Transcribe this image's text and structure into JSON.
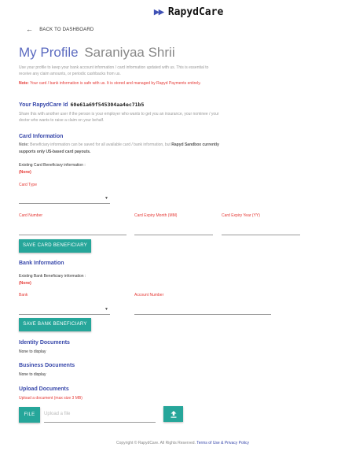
{
  "brand": {
    "name": "RapydCare",
    "arrows": "▶▶"
  },
  "nav": {
    "back_label": "BACK TO DASHBOARD",
    "back_icon": "←"
  },
  "header": {
    "title": "My Profile",
    "user_name": "Saraniyaa Shrii"
  },
  "intro": {
    "line1": "Use your profile to keep your bank account information / card information updated with us. This is essential to",
    "line2": "receive any claim amounts, or periodic cashbacks from us.",
    "note_label": "Note:",
    "note_text": "Your card / bank information is safe with us. It is stored and managed by Rapyd Payments entirely."
  },
  "rapydcare_id": {
    "label": "Your RapydCare Id",
    "value": "60e61a69f545304aa4ec71b5",
    "help1": "Share this with another user if the person is your employer who wants to get you an insurance, your nominee / your",
    "help2": "doctor who wants to raise a claim on your behalf."
  },
  "card_info": {
    "heading": "Card Information",
    "note_label": "Note:",
    "note_text": "Beneficiary information can be saved for all available card / bank information, but",
    "note_bold": "Rapyd Sandbox currently",
    "note_line2": "supports only US-based card payouts.",
    "existing_label": "Existing Card Beneficiary information :",
    "existing_value": "(None)",
    "card_type_label": "Card Type",
    "card_number_label": "Card Number",
    "expiry_month_label": "Card Expiry Month (MM)",
    "expiry_year_label": "Card Expiry Year (YY)",
    "save_button": "SAVE CARD BENEFICIARY"
  },
  "bank_info": {
    "heading": "Bank Information",
    "existing_label": "Existing Bank Beneficiary information :",
    "existing_value": "(None)",
    "bank_label": "Bank",
    "account_label": "Account Number",
    "save_button": "SAVE BANK BENEFICIARY"
  },
  "identity_docs": {
    "heading": "Identity Documents",
    "empty": "None to display"
  },
  "business_docs": {
    "heading": "Business Documents",
    "empty": "None to display"
  },
  "upload": {
    "heading": "Upload Documents",
    "hint": "Upload a document (max size 3 MB)",
    "file_button": "FILE",
    "placeholder": "Upload a file",
    "upload_icon": "upload-icon"
  },
  "footer": {
    "copyright": "Copyright © RapydCare. All Rights Reserved.",
    "link": "Terms of Use & Privacy Policy"
  },
  "colors": {
    "accent": "#3949ab",
    "teal": "#26a69a",
    "red": "#e53935"
  }
}
